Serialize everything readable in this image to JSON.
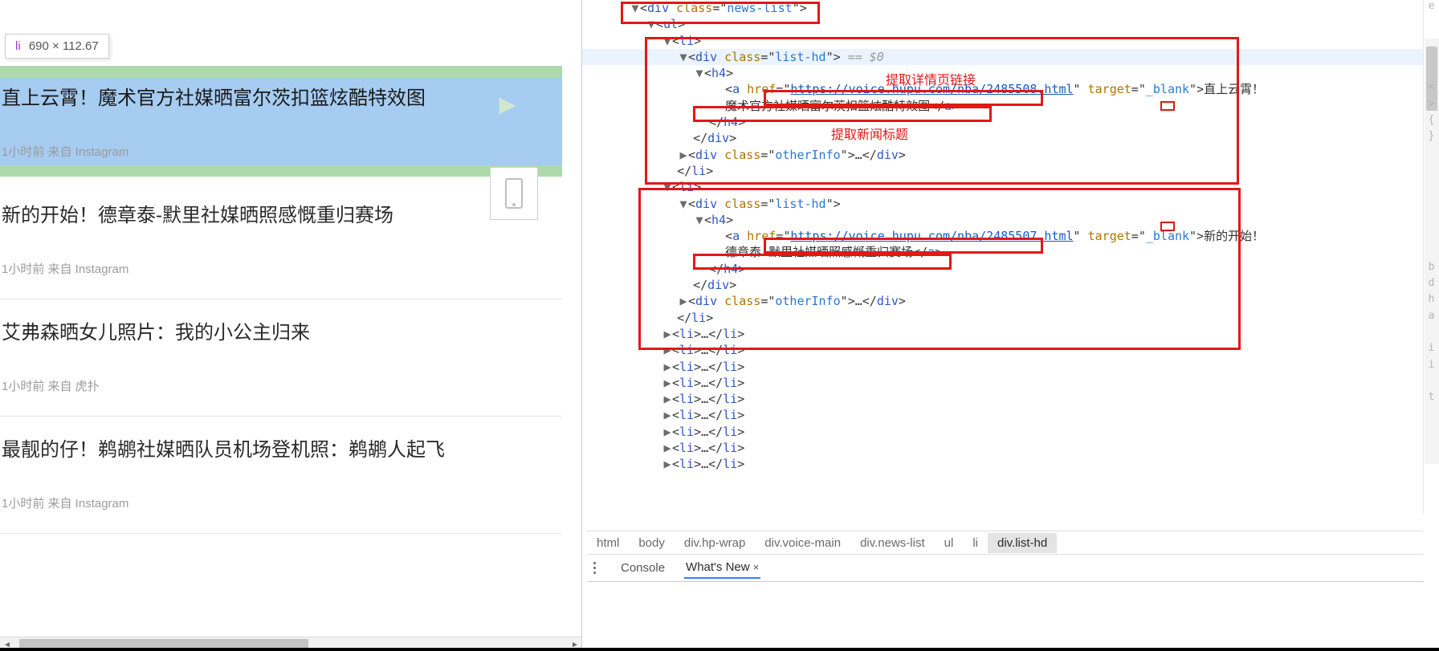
{
  "tooltip": {
    "tag": "li",
    "dims": "690 × 112.67"
  },
  "news": [
    {
      "title": "直上云霄！魔术官方社媒晒富尔茨扣篮炫酷特效图",
      "time": "1小时前",
      "source": "来自 Instagram"
    },
    {
      "title": "新的开始！德章泰-默里社媒晒照感慨重归赛场",
      "time": "1小时前",
      "source": "来自 Instagram"
    },
    {
      "title": "艾弗森晒女儿照片：我的小公主归来",
      "time": "1小时前",
      "source": "来自 虎扑"
    },
    {
      "title": "最靓的仔！鹈鹕社媒晒队员机场登机照：鹈鹕人起飞",
      "time": "1小时前",
      "source": "来自 Instagram"
    }
  ],
  "devtools": {
    "annotations": {
      "link": "提取详情页链接",
      "title": "提取新闻标题"
    },
    "selectedPath": "== $0",
    "class_newslist": "news-list",
    "class_listhd": "list-hd",
    "class_other": "otherInfo",
    "target_blank": "_blank",
    "urls": [
      "https://voice.hupu.com/nba/2485508.html",
      "https://voice.hupu.com/nba/2485507.html"
    ],
    "linkText": [
      "直上云霄！魔术官方社媒晒富尔茨扣篮炫酷特效图",
      "新的开始！德章泰-默里社媒晒照感慨重归赛场"
    ],
    "collapsedLi": "<li>…</li>",
    "ellipsis": "…",
    "breadcrumb": [
      "html",
      "body",
      "div.hp-wrap",
      "div.voice-main",
      "div.news-list",
      "ul",
      "li",
      "div.list-hd"
    ],
    "drawer": {
      "console": "Console",
      "whatsnew": "What's New"
    },
    "gutter": [
      "e",
      "",
      "",
      "",
      "",
      "<",
      ">",
      "{",
      "}",
      "",
      "",
      "",
      "",
      "",
      "",
      "",
      "b",
      "d",
      "h",
      "a",
      "",
      "i",
      "i",
      "",
      "t"
    ]
  }
}
